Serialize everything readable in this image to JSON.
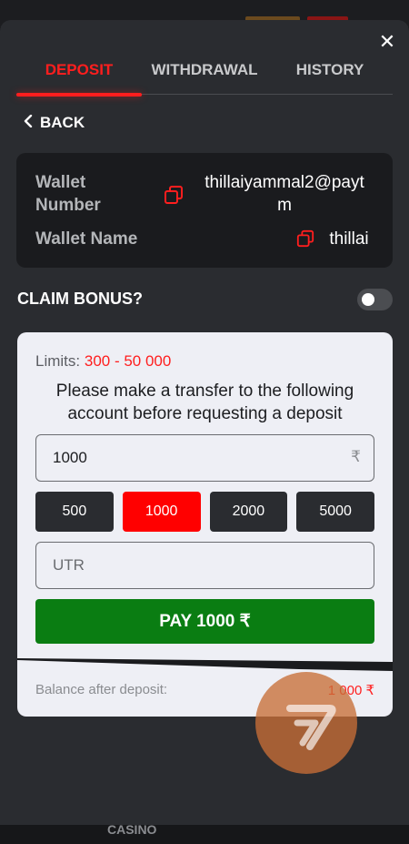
{
  "tabs": [
    {
      "label": "DEPOSIT",
      "active": true
    },
    {
      "label": "WITHDRAWAL",
      "active": false
    },
    {
      "label": "HISTORY",
      "active": false
    }
  ],
  "close_icon": "close-icon",
  "back_label": "BACK",
  "wallet": {
    "number_label_line1": "Wallet",
    "number_label_line2": "Number",
    "number_value_line1": "thillaiyammal2@payt",
    "number_value_line2": "m",
    "name_label": "Wallet Name",
    "name_value": "thillai",
    "copy_icon": "copy-icon"
  },
  "bonus": {
    "label": "CLAIM BONUS?",
    "enabled": false
  },
  "deposit": {
    "limits_label": "Limits:",
    "limits_value": "300 - 50 000",
    "instruction": "Please make a transfer to the following account before requesting a deposit",
    "amount_value": "1000",
    "currency_symbol": "₹",
    "quick_amounts": [
      "500",
      "1000",
      "2000",
      "5000"
    ],
    "selected_amount": "1000",
    "utr_placeholder": "UTR",
    "pay_label": "PAY 1000 ₹",
    "balance_label": "Balance after deposit:",
    "balance_value": "1 000 ₹"
  },
  "bottom_nav": {
    "casino_label": "CASINO"
  },
  "colors": {
    "accent": "#ff1e1e",
    "pay_button": "#0a7d12",
    "modal_bg": "#2a2c30",
    "card_bg": "#eeeff5"
  }
}
